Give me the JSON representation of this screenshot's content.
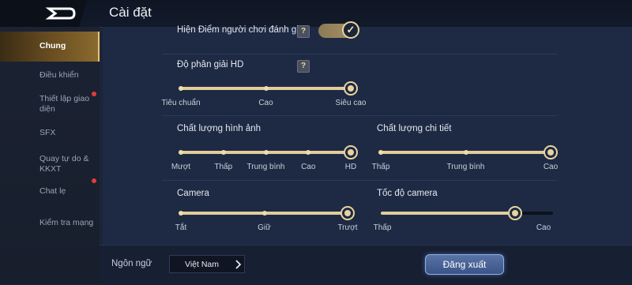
{
  "header": {
    "title": "Cài đặt",
    "back_icon": "back-arrow-icon"
  },
  "sidebar": {
    "items": [
      {
        "label": "Chung",
        "active": true,
        "notify": false
      },
      {
        "label": "Điều khiển",
        "active": false,
        "notify": false
      },
      {
        "label": "Thiết lập giao diện",
        "active": false,
        "notify": true
      },
      {
        "label": "SFX",
        "active": false,
        "notify": false
      },
      {
        "label": "Quay tự do & KKXT",
        "active": false,
        "notify": false
      },
      {
        "label": "Chat lẹ",
        "active": false,
        "notify": true
      },
      {
        "label": "Kiểm tra mạng",
        "active": false,
        "notify": false
      }
    ]
  },
  "settings": {
    "rating_toggle": {
      "label": "Hiện Điểm người chơi đánh giá",
      "help": "?",
      "checked": true,
      "check_glyph": "✓"
    },
    "resolution": {
      "label": "Độ phân giải HD",
      "help": "?",
      "options": [
        "Tiêu chuẩn",
        "Cao",
        "Siêu cao"
      ],
      "selected_index": 2
    },
    "graphics_quality": {
      "label": "Chất lượng hình ảnh",
      "options": [
        "Mượt",
        "Thấp",
        "Trung bình",
        "Cao",
        "HD"
      ],
      "selected_index": 4
    },
    "detail_quality": {
      "label": "Chất lượng chi tiết",
      "options": [
        "Thấp",
        "Trung bình",
        "Cao"
      ],
      "selected_index": 2
    },
    "camera": {
      "label": "Camera",
      "options": [
        "Tắt",
        "Giữ",
        "Trượt"
      ],
      "selected_index": 2
    },
    "camera_speed": {
      "label": "Tốc độ camera",
      "min_label": "Thấp",
      "max_label": "Cao",
      "value_fraction": 0.78
    }
  },
  "footer": {
    "language_label": "Ngôn ngữ",
    "language_value": "Việt Nam",
    "logout_label": "Đăng xuất"
  },
  "colors": {
    "accent_gold": "#e8d3a0",
    "panel_bg": "#1e2a44",
    "button_blue": "#4a66a0"
  }
}
